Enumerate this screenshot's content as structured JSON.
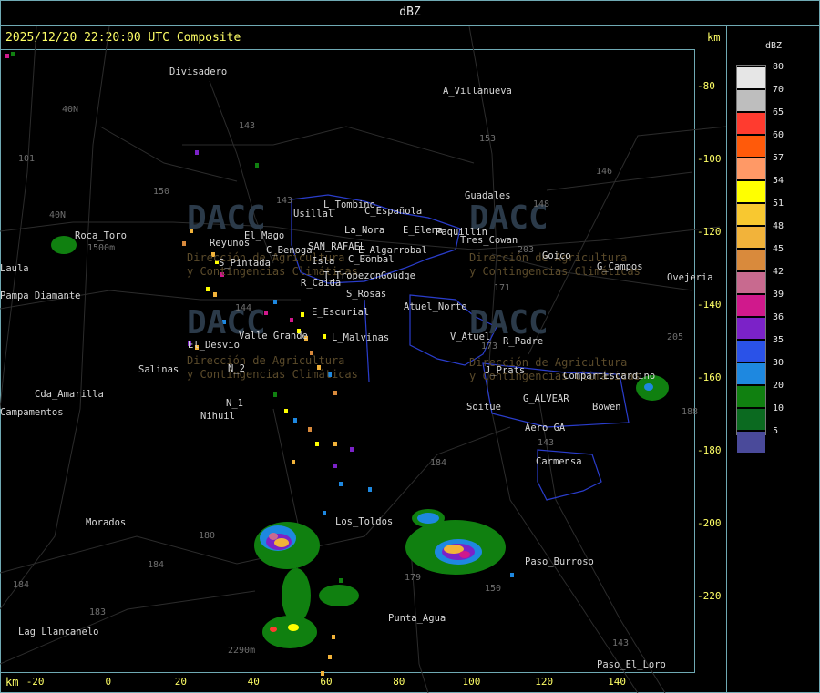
{
  "title": "dBZ",
  "header": "2025/12/20 22:20:00 UTC Composite",
  "unit_km": "km",
  "x_ticks": [
    {
      "v": -20,
      "t": "-20"
    },
    {
      "v": 0,
      "t": "0"
    },
    {
      "v": 20,
      "t": "20"
    },
    {
      "v": 40,
      "t": "40"
    },
    {
      "v": 60,
      "t": "60"
    },
    {
      "v": 80,
      "t": "80"
    },
    {
      "v": 100,
      "t": "100"
    },
    {
      "v": 120,
      "t": "120"
    },
    {
      "v": 140,
      "t": "140"
    }
  ],
  "y_ticks": [
    {
      "v": -80,
      "t": "-80"
    },
    {
      "v": -100,
      "t": "-100"
    },
    {
      "v": -120,
      "t": "-120"
    },
    {
      "v": -140,
      "t": "-140"
    },
    {
      "v": -160,
      "t": "-160"
    },
    {
      "v": -180,
      "t": "-180"
    },
    {
      "v": -200,
      "t": "-200"
    },
    {
      "v": -220,
      "t": "-220"
    }
  ],
  "legend": {
    "title": "dBZ",
    "levels": [
      {
        "label": "80",
        "color": "#e6e6e6"
      },
      {
        "label": "70",
        "color": "#bebebe"
      },
      {
        "label": "65",
        "color": "#ff3b2f"
      },
      {
        "label": "60",
        "color": "#ff5a0a"
      },
      {
        "label": "57",
        "color": "#ff9966"
      },
      {
        "label": "54",
        "color": "#ffff00"
      },
      {
        "label": "51",
        "color": "#f8c830"
      },
      {
        "label": "48",
        "color": "#f2b33a"
      },
      {
        "label": "45",
        "color": "#d98a3c"
      },
      {
        "label": "42",
        "color": "#c86a8f"
      },
      {
        "label": "39",
        "color": "#d0198c"
      },
      {
        "label": "36",
        "color": "#7b22c8"
      },
      {
        "label": "35",
        "color": "#2a52e8"
      },
      {
        "label": "30",
        "color": "#1e88e0"
      },
      {
        "label": "20",
        "color": "#108010"
      },
      {
        "label": "10",
        "color": "#0b6a20"
      },
      {
        "label": "5",
        "color": "#4a4a9a"
      }
    ]
  },
  "places": [
    {
      "t": "Divisadero"
    },
    {
      "t": "A_Villanueva"
    },
    {
      "t": "Guadales"
    },
    {
      "t": "L_Tombino"
    },
    {
      "t": "Usillal"
    },
    {
      "t": "C_Española"
    },
    {
      "t": "La_Nora"
    },
    {
      "t": "E_Elena"
    },
    {
      "t": "Paquillin"
    },
    {
      "t": "Roca_Toro"
    },
    {
      "t": "Reyunos"
    },
    {
      "t": "El_Mago"
    },
    {
      "t": "C_Benoga"
    },
    {
      "t": "SAN_RAFAEL"
    },
    {
      "t": "E_Algarrobal"
    },
    {
      "t": "C_Bombal"
    },
    {
      "t": "Goico"
    },
    {
      "t": "G_Campos"
    },
    {
      "t": "Ovejeria"
    },
    {
      "t": "Pampa_Diamante"
    },
    {
      "t": "Laula"
    },
    {
      "t": "S_Pintada"
    },
    {
      "t": "Isla"
    },
    {
      "t": "T_Tropezon"
    },
    {
      "t": "Goudge"
    },
    {
      "t": "R_Caida"
    },
    {
      "t": "S_Rosas"
    },
    {
      "t": "Atuel_Norte"
    },
    {
      "t": "E_Escurial"
    },
    {
      "t": "Valle_Grande"
    },
    {
      "t": "L_Malvinas"
    },
    {
      "t": "V_Atuel"
    },
    {
      "t": "R_Padre"
    },
    {
      "t": "El_Desvio"
    },
    {
      "t": "Salinas"
    },
    {
      "t": "N_2"
    },
    {
      "t": "J_Prats"
    },
    {
      "t": "CompartEscardino"
    },
    {
      "t": "Cda_Amarilla"
    },
    {
      "t": "G_ALVEAR"
    },
    {
      "t": "N_1"
    },
    {
      "t": "Soitue"
    },
    {
      "t": "Bowen"
    },
    {
      "t": "Nihuil"
    },
    {
      "t": "Campamentos"
    },
    {
      "t": "Aero_GA"
    },
    {
      "t": "Carmensa"
    },
    {
      "t": "Morados"
    },
    {
      "t": "Los_Toldos"
    },
    {
      "t": "Paso_Burroso"
    },
    {
      "t": "Punta_Agua"
    },
    {
      "t": "Lag_Llancanelo"
    },
    {
      "t": "Paso_El_Loro"
    },
    {
      "t": "Tres_Cowan"
    }
  ],
  "roads": [
    {
      "t": "143"
    },
    {
      "t": "153"
    },
    {
      "t": "146"
    },
    {
      "t": "101"
    },
    {
      "t": "40N"
    },
    {
      "t": "150"
    },
    {
      "t": "143"
    },
    {
      "t": "148"
    },
    {
      "t": "203"
    },
    {
      "t": "171"
    },
    {
      "t": "144"
    },
    {
      "t": "40N"
    },
    {
      "t": "205"
    },
    {
      "t": "173"
    },
    {
      "t": "180"
    },
    {
      "t": "184"
    },
    {
      "t": "183"
    },
    {
      "t": "184"
    },
    {
      "t": "179"
    },
    {
      "t": "150"
    },
    {
      "t": "143"
    },
    {
      "t": "188"
    },
    {
      "t": "2290m"
    },
    {
      "t": "1500m"
    },
    {
      "t": "184"
    },
    {
      "t": "143"
    }
  ],
  "watermark": {
    "brand": "DACC",
    "line1": "Dirección de Agricultura",
    "line2": "y Contingencias Climáticas"
  }
}
